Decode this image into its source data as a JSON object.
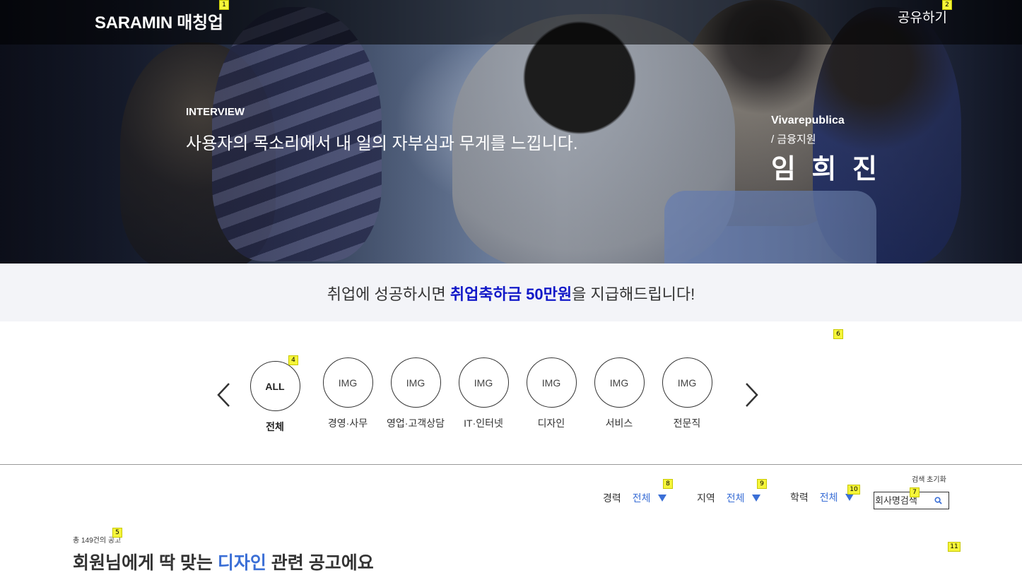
{
  "header": {
    "logo": "SARAMIN 매칭업",
    "share_label": "공유하기"
  },
  "hero": {
    "eyebrow": "INTERVIEW",
    "quote": "사용자의 목소리에서 내 일의 자부심과 무게를 느낍니다.",
    "company": "Vivarepublica",
    "department": "/ 금융지원",
    "name": "임 희 진"
  },
  "banner": {
    "prefix": "취업에 성공하시면 ",
    "highlight": "취업축하금 50만원",
    "suffix": "을 지급해드립니다!"
  },
  "categories": [
    {
      "icon": "ALL",
      "label": "전체",
      "active": true
    },
    {
      "icon": "IMG",
      "label": "경영·사무"
    },
    {
      "icon": "IMG",
      "label": "영업·고객상담"
    },
    {
      "icon": "IMG",
      "label": "IT·인터넷"
    },
    {
      "icon": "IMG",
      "label": "디자인"
    },
    {
      "icon": "IMG",
      "label": "서비스"
    },
    {
      "icon": "IMG",
      "label": "전문직"
    }
  ],
  "filters": {
    "reset_label": "검색 초기화",
    "experience": {
      "label": "경력",
      "value": "전체"
    },
    "region": {
      "label": "지역",
      "value": "전체"
    },
    "education": {
      "label": "학력",
      "value": "전체"
    },
    "search_placeholder": "회사명검색"
  },
  "results": {
    "count_text": "총 149건의 공고",
    "headline_prefix": "회원님에게 딱 맞는 ",
    "headline_highlight": "디자인",
    "headline_suffix": " 관련 공고에요"
  },
  "markers": [
    "1",
    "2",
    "4",
    "6",
    "8",
    "9",
    "10",
    "7",
    "5",
    "11"
  ],
  "colors": {
    "accent_blue": "#3b6fd6",
    "banner_highlight": "#1118c8",
    "marker": "#f5f53a"
  }
}
